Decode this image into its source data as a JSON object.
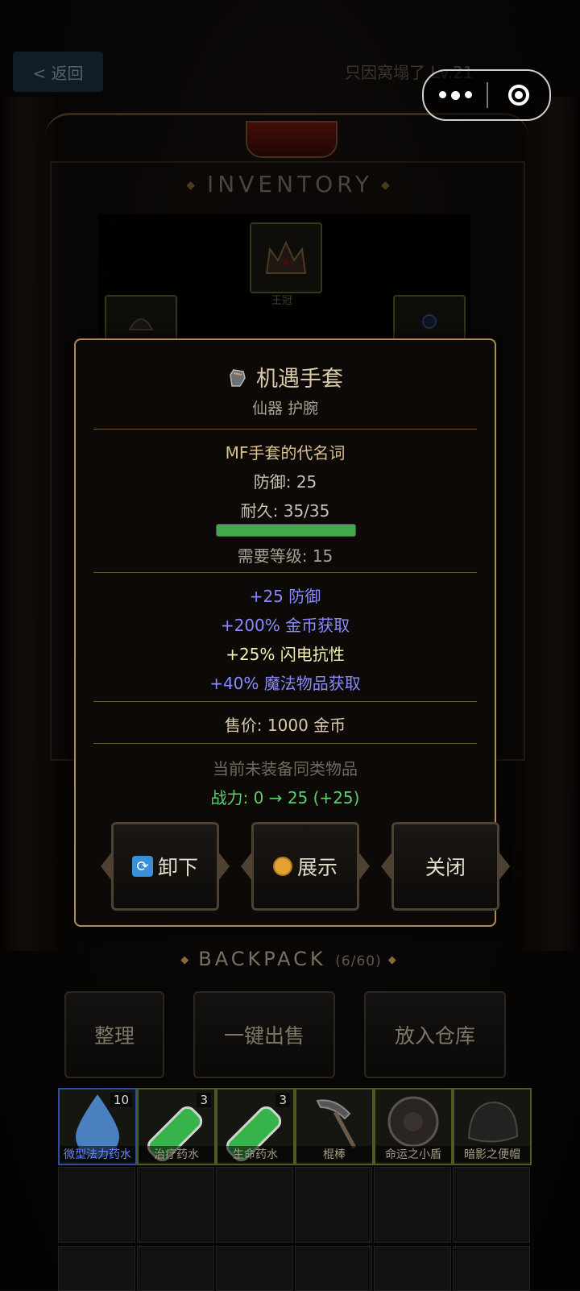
{
  "topbar": {
    "back_label": "< 返回",
    "player_title": "只因窝塌了 Lv.21"
  },
  "inventory": {
    "title": "INVENTORY",
    "slots": [
      {
        "label": "王冠",
        "icon": "crown-icon"
      },
      {
        "label": "",
        "icon": "helm-icon"
      },
      {
        "label": "",
        "icon": "amulet-icon"
      }
    ]
  },
  "item_modal": {
    "name": "机遇手套",
    "icon": "gauntlet-icon",
    "subtitle": "仙器 护腕",
    "flavor": "MF手套的代名词",
    "defense": "防御: 25",
    "durability": "耐久: 35/35",
    "durability_fraction": 1.0,
    "required_level": "需要等级: 15",
    "affixes": [
      {
        "text": "+25 防御",
        "color": "#8a8aff"
      },
      {
        "text": "+200% 金币获取",
        "color": "#8a8aff"
      },
      {
        "text": "+25% 闪电抗性",
        "color": "#f4efb0"
      },
      {
        "text": "+40% 魔法物品获取",
        "color": "#8a8aff"
      }
    ],
    "sell_price": "售价: 1000 金币",
    "compare_note": "当前未装备同类物品",
    "power_change": "战力: 0 → 25 (+25)",
    "buttons": {
      "unequip": "卸下",
      "showcase": "展示",
      "close": "关闭"
    },
    "colors": {
      "border": "#b08a52",
      "positive": "#5ccf6e",
      "magic": "#8a8aff",
      "lightning": "#f4efb0"
    }
  },
  "backpack": {
    "title": "BACKPACK",
    "count": "(6/60)",
    "actions": {
      "sort": "整理",
      "sell_all": "一键出售",
      "to_storage": "放入仓库"
    },
    "items": [
      {
        "name": "微型法力药水",
        "count": "10",
        "icon": "mana-drop-icon",
        "rarity": "blue"
      },
      {
        "name": "治疗药水",
        "count": "3",
        "icon": "potion-icon",
        "rarity": "normal"
      },
      {
        "name": "生命药水",
        "count": "3",
        "icon": "potion-icon",
        "rarity": "normal"
      },
      {
        "name": "棍棒",
        "count": "",
        "icon": "club-icon",
        "rarity": "normal"
      },
      {
        "name": "命运之小盾",
        "count": "",
        "icon": "shield-icon",
        "rarity": "normal"
      },
      {
        "name": "暗影之便帽",
        "count": "",
        "icon": "cap-icon",
        "rarity": "normal"
      }
    ]
  }
}
